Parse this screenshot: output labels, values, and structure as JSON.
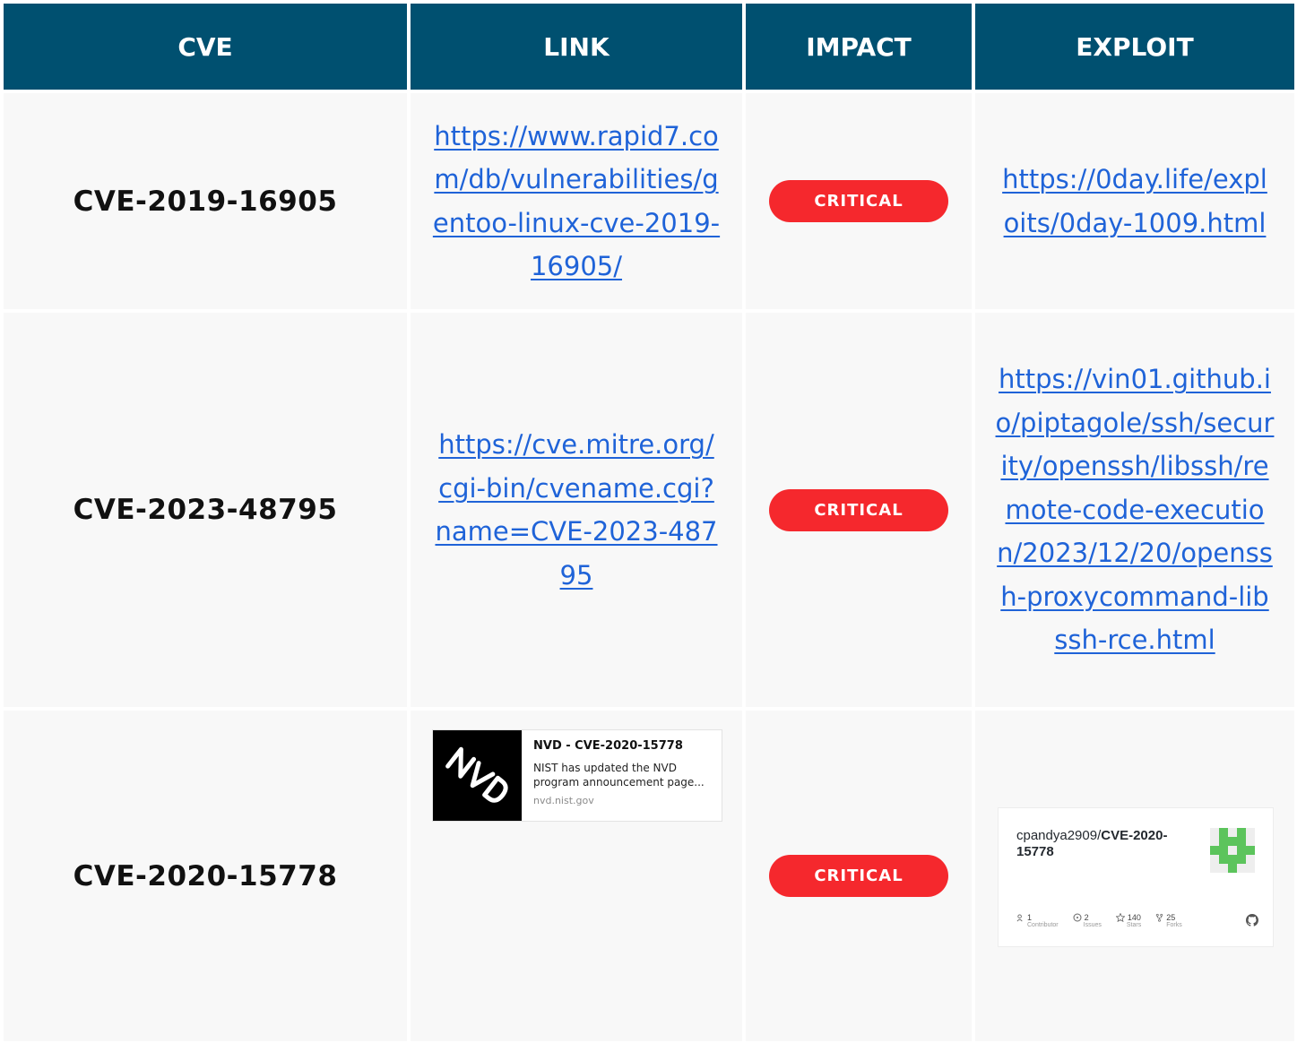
{
  "headers": [
    "CVE",
    "LINK",
    "IMPACT",
    "EXPLOIT"
  ],
  "rows": [
    {
      "cve": "CVE-2019-16905",
      "link": "https://www.rapid7.com/db/vulnerabilities/gentoo-linux-cve-2019-16905/",
      "impact": "CRITICAL",
      "exploit": "https://0day.life/exploits/0day-1009.html"
    },
    {
      "cve": "CVE-2023-48795",
      "link": "https://cve.mitre.org/cgi-bin/cvename.cgi?name=CVE-2023-48795",
      "impact": "CRITICAL",
      "exploit": "https://vin01.github.io/piptagole/ssh/security/openssh/libssh/remote-code-execution/2023/12/20/openssh-proxycommand-libssh-rce.html"
    },
    {
      "cve": "CVE-2020-15778",
      "impact": "CRITICAL",
      "link_card": {
        "logo_icon": "nvd-logo-icon",
        "title": "NVD - CVE-2020-15778",
        "description": "NIST has updated the NVD program announcement page...",
        "domain": "nvd.nist.gov"
      },
      "exploit_card": {
        "owner": "cpandya2909/",
        "repo": "CVE-2020-15778",
        "avatar_icon": "identicon-avatar-icon",
        "stats": [
          {
            "icon": "contributor-icon",
            "value": "1",
            "label": "Contributor"
          },
          {
            "icon": "issues-icon",
            "value": "2",
            "label": "Issues"
          },
          {
            "icon": "star-icon",
            "value": "140",
            "label": "Stars"
          },
          {
            "icon": "fork-icon",
            "value": "25",
            "label": "Forks"
          }
        ],
        "brand_icon": "github-icon"
      }
    }
  ],
  "colors": {
    "header_bg": "#005070",
    "header_text": "#ffffff",
    "cell_bg": "#f8f8f8",
    "link": "#1f63d8",
    "critical_badge": "#f5282d",
    "identicon": "#5cc45c"
  }
}
